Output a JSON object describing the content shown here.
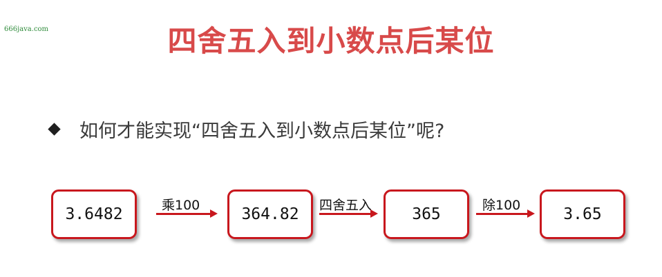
{
  "watermark": "666java.com",
  "title": "四舍五入到小数点后某位",
  "question": "如何才能实现“四舍五入到小数点后某位”呢?",
  "flow": {
    "values": [
      "3.6482",
      "364.82",
      "365",
      "3.65"
    ],
    "operations": [
      "乘100",
      "四舍五入",
      "除100"
    ]
  },
  "colors": {
    "title": "#d84a4a",
    "box_border": "#c8171d",
    "arrow": "#c8171d",
    "watermark": "#2e8b3a"
  }
}
